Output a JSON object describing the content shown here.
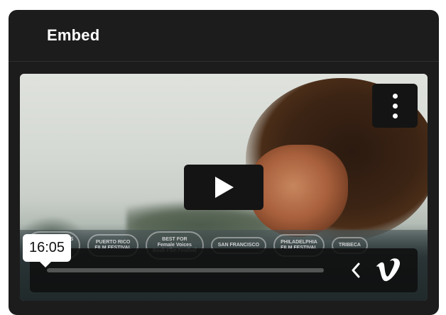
{
  "card": {
    "title": "Embed"
  },
  "player": {
    "duration": "16:05",
    "progress": 0.0,
    "laurels": [
      "VIENNA SHORTS\nOFFICIAL\nSELECTION",
      "PUERTO RICO\nFILM FESTIVAL",
      "BEST FOR\nFemale Voices\nBook Film Festival",
      "SAN FRANCISCO",
      "PHILADELPHIA\nFILM FESTIVAL",
      "TRIBECA"
    ],
    "icons": {
      "menu": "more-vertical-icon",
      "play": "play-icon",
      "chevron": "chevron-left-icon",
      "logo": "vimeo-logo"
    }
  },
  "colors": {
    "card_bg": "#1c1c1c",
    "overlay": "#141414",
    "tooltip_bg": "#ffffff"
  }
}
